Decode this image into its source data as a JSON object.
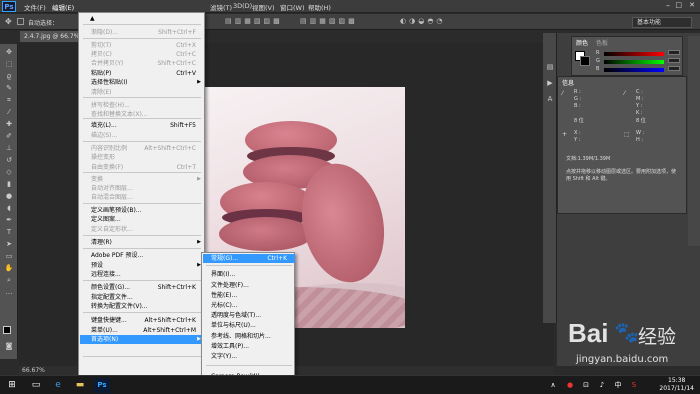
{
  "app": {
    "logo": "Ps"
  },
  "menubar": {
    "items": [
      "文件(F)",
      "编辑(E)",
      "图像(I)",
      "图层(L)",
      "文字(Y)",
      "选择(S)",
      "滤镜(T)",
      "3D(D)",
      "视图(V)",
      "窗口(W)",
      "帮助(H)"
    ]
  },
  "optbar": {
    "auto_select": "自动选择：",
    "workspace": "基本功能"
  },
  "document": {
    "tab_label": "2.4.7.jpg @ 66.7%",
    "zoom": "66.67%",
    "doc_info": "文档:1.39M/1.39M"
  },
  "edit_menu": {
    "items": [
      {
        "label": "",
        "shortcut": "",
        "state": "normal"
      },
      {
        "label": "渐隐(D)...",
        "shortcut": "Shift+Ctrl+F",
        "state": "disabled"
      },
      {
        "label": "剪切(T)",
        "shortcut": "Ctrl+X",
        "state": "disabled"
      },
      {
        "label": "拷贝(C)",
        "shortcut": "Ctrl+C",
        "state": "disabled"
      },
      {
        "label": "合并拷贝(Y)",
        "shortcut": "Shift+Ctrl+C",
        "state": "disabled"
      },
      {
        "label": "粘贴(P)",
        "shortcut": "Ctrl+V",
        "state": "normal"
      },
      {
        "label": "选择性粘贴(I)",
        "shortcut": "",
        "state": "normal"
      },
      {
        "label": "清除(E)",
        "shortcut": "",
        "state": "disabled"
      },
      {
        "label": "拼写检查(H)...",
        "shortcut": "",
        "state": "disabled"
      },
      {
        "label": "查找和替换文本(X)...",
        "shortcut": "",
        "state": "disabled"
      },
      {
        "label": "填充(L)...",
        "shortcut": "Shift+F5",
        "state": "normal"
      },
      {
        "label": "描边(S)...",
        "shortcut": "",
        "state": "disabled"
      },
      {
        "label": "内容识别比例",
        "shortcut": "Alt+Shift+Ctrl+C",
        "state": "disabled"
      },
      {
        "label": "操控变形",
        "shortcut": "",
        "state": "disabled"
      },
      {
        "label": "自由变换(F)",
        "shortcut": "Ctrl+T",
        "state": "disabled"
      },
      {
        "label": "变换",
        "shortcut": "",
        "state": "disabled"
      },
      {
        "label": "自动对齐图层...",
        "shortcut": "",
        "state": "disabled"
      },
      {
        "label": "自动混合图层...",
        "shortcut": "",
        "state": "disabled"
      },
      {
        "label": "定义画笔预设(B)...",
        "shortcut": "",
        "state": "normal"
      },
      {
        "label": "定义图案...",
        "shortcut": "",
        "state": "normal"
      },
      {
        "label": "定义自定形状...",
        "shortcut": "",
        "state": "disabled"
      },
      {
        "label": "清理(R)",
        "shortcut": "",
        "state": "normal"
      },
      {
        "label": "Adobe PDF 预设...",
        "shortcut": "",
        "state": "normal"
      },
      {
        "label": "预设",
        "shortcut": "",
        "state": "normal"
      },
      {
        "label": "远程连接...",
        "shortcut": "",
        "state": "normal"
      },
      {
        "label": "颜色设置(G)...",
        "shortcut": "Shift+Ctrl+K",
        "state": "normal"
      },
      {
        "label": "指定配置文件...",
        "shortcut": "",
        "state": "normal"
      },
      {
        "label": "转换为配置文件(V)...",
        "shortcut": "",
        "state": "normal"
      },
      {
        "label": "键盘快捷键...",
        "shortcut": "Alt+Shift+Ctrl+K",
        "state": "normal"
      },
      {
        "label": "菜单(U)...",
        "shortcut": "Alt+Shift+Ctrl+M",
        "state": "normal"
      },
      {
        "label": "首选项(N)",
        "shortcut": "",
        "state": "highlighted"
      }
    ]
  },
  "prefs_submenu": {
    "items": [
      {
        "label": "常规(G)...",
        "shortcut": "Ctrl+K",
        "highlighted": true
      },
      {
        "label": "界面(I)...",
        "shortcut": ""
      },
      {
        "label": "文件处理(F)...",
        "shortcut": ""
      },
      {
        "label": "性能(E)...",
        "shortcut": ""
      },
      {
        "label": "光标(C)...",
        "shortcut": ""
      },
      {
        "label": "透明度与色域(T)...",
        "shortcut": ""
      },
      {
        "label": "单位与标尺(U)...",
        "shortcut": ""
      },
      {
        "label": "参考线、网格和切片...",
        "shortcut": ""
      },
      {
        "label": "增效工具(P)...",
        "shortcut": ""
      },
      {
        "label": "文字(Y)...",
        "shortcut": ""
      },
      {
        "label": "Camera Raw(W)...",
        "shortcut": ""
      }
    ]
  },
  "color_panel": {
    "tabs": [
      "颜色",
      "色板"
    ],
    "labels": [
      "R",
      "G",
      "B"
    ]
  },
  "info_panel": {
    "title": "信息",
    "labels": [
      "R :",
      "G :",
      "B :",
      "C :",
      "M :",
      "Y :",
      "K :",
      "8 位",
      "X :",
      "Y :",
      "W :",
      "H :"
    ],
    "hint": "点按并拖移以移动图层或选区。要用附加选项，使用 Shift 和 Alt 键。"
  },
  "taskbar": {
    "time": "15:38",
    "date": "2017/11/14"
  },
  "watermark": {
    "brand": "Bai",
    "brand_suffix": "经验",
    "url": "jingyan.baidu.com"
  }
}
